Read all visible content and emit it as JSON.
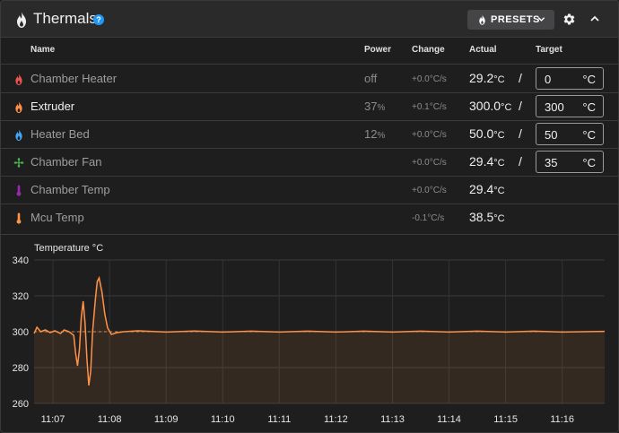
{
  "header": {
    "title": "Thermals",
    "help_icon": "question-circle-icon",
    "presets_label": "PRESETS",
    "icons": [
      "fire-icon",
      "chevron-down-icon",
      "gear-icon",
      "chevron-up-icon"
    ]
  },
  "columns": {
    "name": "Name",
    "power": "Power",
    "change": "Change",
    "actual": "Actual",
    "target": "Target"
  },
  "rows": [
    {
      "icon": "fire-icon",
      "color": "#ef5350",
      "name": "Chamber Heater",
      "power": "off",
      "power_unit": "",
      "change": "+0.0°C/s",
      "actual": "29.2",
      "actual_unit": "°C",
      "target": "0",
      "target_unit": "°C"
    },
    {
      "icon": "fire-icon",
      "color": "#ff9248",
      "name": "Extruder",
      "power": "37",
      "power_unit": "%",
      "change": "+0.1°C/s",
      "actual": "300.0",
      "actual_unit": "°C",
      "target": "300",
      "target_unit": "°C"
    },
    {
      "icon": "fire-icon",
      "color": "#42a5f5",
      "name": "Heater Bed",
      "power": "12",
      "power_unit": "%",
      "change": "+0.0°C/s",
      "actual": "50.0",
      "actual_unit": "°C",
      "target": "50",
      "target_unit": "°C"
    },
    {
      "icon": "fan-icon",
      "color": "#4caf50",
      "name": "Chamber Fan",
      "power": "",
      "power_unit": "",
      "change": "+0.0°C/s",
      "actual": "29.4",
      "actual_unit": "°C",
      "target": "35",
      "target_unit": "°C"
    },
    {
      "icon": "thermometer-icon",
      "color": "#9c27b0",
      "name": "Chamber Temp",
      "power": "",
      "power_unit": "",
      "change": "+0.0°C/s",
      "actual": "29.4",
      "actual_unit": "°C"
    },
    {
      "icon": "thermometer-icon",
      "color": "#ff9248",
      "name": "Mcu Temp",
      "power": "",
      "power_unit": "",
      "change": "-0.1°C/s",
      "actual": "38.5",
      "actual_unit": "°C"
    }
  ],
  "chart_data": {
    "type": "line",
    "title": "Temperature °C",
    "ylim": [
      260,
      340
    ],
    "yticks": [
      260,
      280,
      300,
      320,
      340
    ],
    "xlim": [
      "11:06:40",
      "11:16:45"
    ],
    "xticks": [
      "11:07",
      "11:08",
      "11:09",
      "11:10",
      "11:11",
      "11:12",
      "11:13",
      "11:14",
      "11:15",
      "11:16"
    ],
    "grid": true,
    "series": [
      {
        "color": "#ff9248",
        "fill": true,
        "style": "solid",
        "points": [
          [
            "11:06:40",
            299
          ],
          [
            "11:06:43",
            302.5
          ],
          [
            "11:06:47",
            300
          ],
          [
            "11:06:52",
            301
          ],
          [
            "11:06:57",
            299.5
          ],
          [
            "11:07:02",
            300.5
          ],
          [
            "11:07:08",
            299
          ],
          [
            "11:07:12",
            301
          ],
          [
            "11:07:17",
            300
          ],
          [
            "11:07:22",
            298
          ],
          [
            "11:07:24",
            288
          ],
          [
            "11:07:26",
            281
          ],
          [
            "11:07:28",
            290
          ],
          [
            "11:07:30",
            308
          ],
          [
            "11:07:32",
            317
          ],
          [
            "11:07:34",
            305
          ],
          [
            "11:07:36",
            285
          ],
          [
            "11:07:38",
            270
          ],
          [
            "11:07:40",
            278
          ],
          [
            "11:07:42",
            300
          ],
          [
            "11:07:45",
            318
          ],
          [
            "11:07:47",
            328
          ],
          [
            "11:07:49",
            330
          ],
          [
            "11:07:52",
            322
          ],
          [
            "11:07:55",
            310
          ],
          [
            "11:07:58",
            302
          ],
          [
            "11:08:02",
            298.5
          ],
          [
            "11:08:08",
            299.5
          ],
          [
            "11:08:15",
            300
          ],
          [
            "11:08:30",
            300.5
          ],
          [
            "11:09:00",
            299.8
          ],
          [
            "11:09:30",
            300.4
          ],
          [
            "11:10:00",
            299.8
          ],
          [
            "11:10:30",
            300.3
          ],
          [
            "11:11:00",
            299.8
          ],
          [
            "11:11:30",
            300.3
          ],
          [
            "11:12:00",
            299.8
          ],
          [
            "11:12:30",
            300.3
          ],
          [
            "11:13:00",
            299.8
          ],
          [
            "11:13:30",
            300.3
          ],
          [
            "11:14:00",
            299.8
          ],
          [
            "11:14:30",
            300.3
          ],
          [
            "11:15:00",
            299.8
          ],
          [
            "11:15:30",
            300.3
          ],
          [
            "11:16:00",
            299.8
          ],
          [
            "11:16:45",
            300.2
          ]
        ]
      },
      {
        "color": "#ff9248",
        "fill": false,
        "style": "dashed",
        "points": [
          [
            "11:06:40",
            300
          ],
          [
            "11:16:45",
            300
          ]
        ]
      }
    ]
  }
}
